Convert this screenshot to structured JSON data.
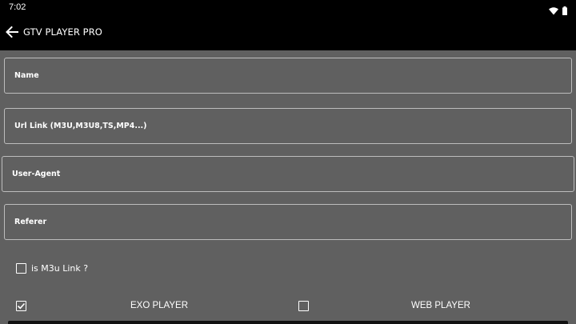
{
  "status_bar": {
    "time": "7:02",
    "icons": [
      "wifi-icon",
      "battery-icon"
    ]
  },
  "app_bar": {
    "title": "GTV PLAYER PRO",
    "back_icon": "arrow-back-icon"
  },
  "form": {
    "name": {
      "placeholder": "Name",
      "value": ""
    },
    "url": {
      "placeholder": "Url Link (M3U,M3U8,TS,MP4...)",
      "value": ""
    },
    "user_agent": {
      "placeholder": "User-Agent",
      "value": ""
    },
    "referer": {
      "placeholder": "Referer",
      "value": ""
    },
    "is_m3u": {
      "label": "is M3u Link ?",
      "checked": false
    }
  },
  "players": {
    "exo": {
      "label": "EXO PLAYER",
      "checked": true
    },
    "web": {
      "label": "WEB PLAYER",
      "checked": false
    }
  },
  "colors": {
    "background": "#606060",
    "bar": "#000000",
    "border": "#bdbdbd",
    "text": "#ffffff"
  }
}
